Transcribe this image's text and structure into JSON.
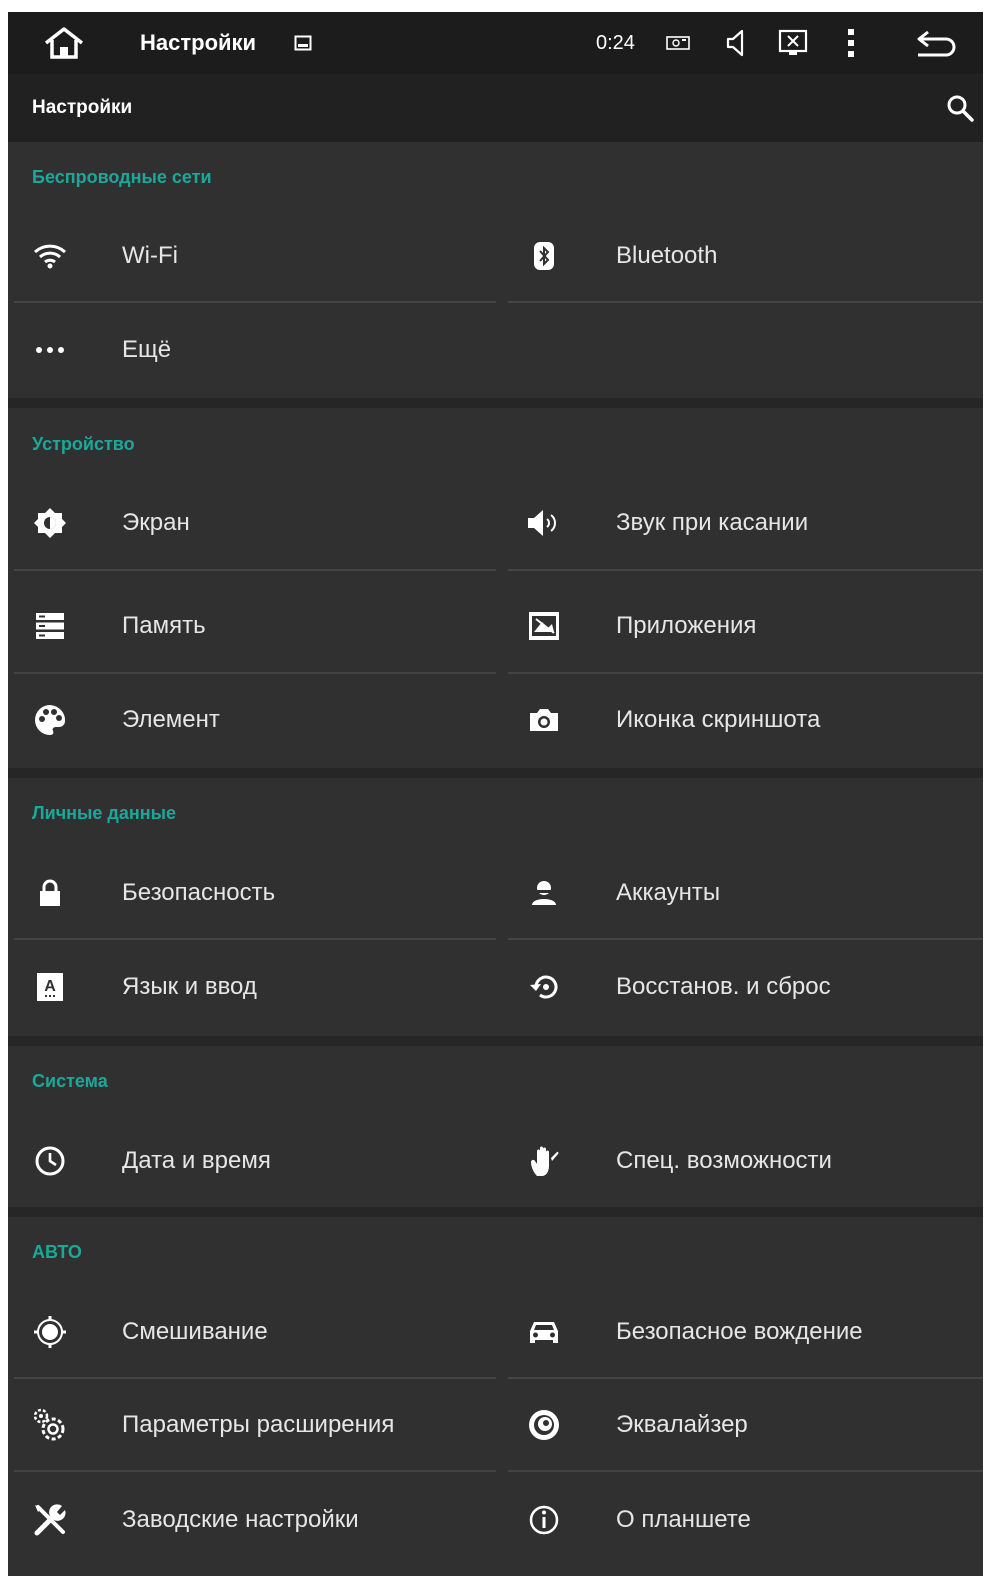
{
  "statusbar": {
    "title": "Настройки",
    "time": "0:24",
    "icons": [
      "home-icon",
      "image-icon",
      "screenshot-icon",
      "volume-icon",
      "close-screen-icon",
      "overflow-menu-icon",
      "back-icon"
    ]
  },
  "actionbar": {
    "title": "Настройки",
    "search_icon": "search-icon"
  },
  "colors": {
    "background": "#303030",
    "statusbar": "#1c1c1c",
    "actionbar": "#212121",
    "section_header": "#1ba89a",
    "text": "#e6e6e6"
  },
  "sections": [
    {
      "title": "Беспроводные сети",
      "items": [
        {
          "label": "Wi-Fi",
          "icon": "wifi-icon"
        },
        {
          "label": "Bluetooth",
          "icon": "bluetooth-icon"
        },
        {
          "label": "Ещё",
          "icon": "more-icon"
        }
      ]
    },
    {
      "title": "Устройство",
      "items": [
        {
          "label": "Экран",
          "icon": "brightness-icon"
        },
        {
          "label": "Звук при касании",
          "icon": "sound-icon"
        },
        {
          "label": "Память",
          "icon": "storage-icon"
        },
        {
          "label": "Приложения",
          "icon": "apps-icon"
        },
        {
          "label": "Элемент",
          "icon": "palette-icon"
        },
        {
          "label": "Иконка скриншота",
          "icon": "camera-icon"
        }
      ]
    },
    {
      "title": "Личные данные",
      "items": [
        {
          "label": "Безопасность",
          "icon": "lock-icon"
        },
        {
          "label": "Аккаунты",
          "icon": "account-icon"
        },
        {
          "label": "Язык и ввод",
          "icon": "language-icon"
        },
        {
          "label": "Восстанов. и сброс",
          "icon": "restore-icon"
        }
      ]
    },
    {
      "title": "Система",
      "items": [
        {
          "label": "Дата и время",
          "icon": "clock-icon"
        },
        {
          "label": "Спец. возможности",
          "icon": "hand-icon"
        }
      ]
    },
    {
      "title": "АВТО",
      "items": [
        {
          "label": "Смешивание",
          "icon": "mix-icon"
        },
        {
          "label": "Безопасное вождение",
          "icon": "car-icon"
        },
        {
          "label": "Параметры расширения",
          "icon": "extension-settings-icon"
        },
        {
          "label": "Эквалайзер",
          "icon": "equalizer-icon"
        },
        {
          "label": "Заводские настройки",
          "icon": "tools-icon"
        },
        {
          "label": "О планшете",
          "icon": "info-icon"
        }
      ]
    }
  ]
}
